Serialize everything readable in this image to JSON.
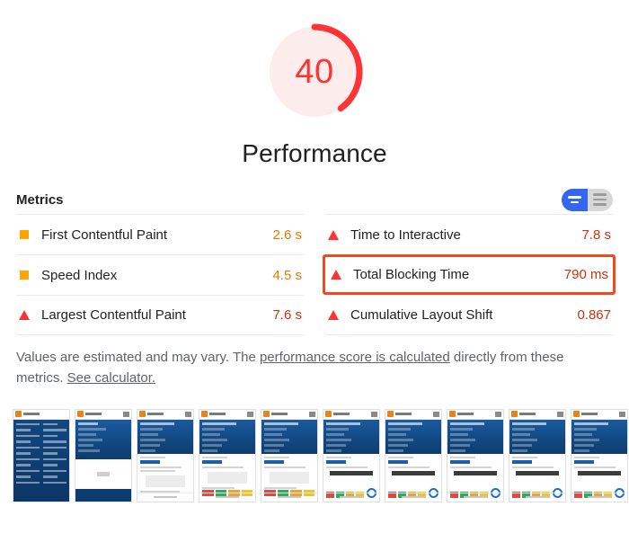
{
  "gauge": {
    "score": "40",
    "category_label": "Performance",
    "score_color": "#f33",
    "track_color": "#fdecec",
    "arc_percent": 40
  },
  "metrics_section": {
    "title": "Metrics",
    "toggle": {
      "simple_view_name": "simple-view-icon",
      "detail_view_name": "detail-view-icon",
      "active": "simple",
      "active_color": "#3367f0",
      "inactive_color": "#d8d8d8"
    },
    "left_column": [
      {
        "label": "First Contentful Paint",
        "value": "2.6 s",
        "rating": "average",
        "icon": "square-icon",
        "icon_color": "#ffa400",
        "highlighted": false
      },
      {
        "label": "Speed Index",
        "value": "4.5 s",
        "rating": "average",
        "icon": "square-icon",
        "icon_color": "#ffa400",
        "highlighted": false
      },
      {
        "label": "Largest Contentful Paint",
        "value": "7.6 s",
        "rating": "fail",
        "icon": "triangle-icon",
        "icon_color": "#f33",
        "highlighted": false
      }
    ],
    "right_column": [
      {
        "label": "Time to Interactive",
        "value": "7.8 s",
        "rating": "fail",
        "icon": "triangle-icon",
        "icon_color": "#f33",
        "highlighted": false
      },
      {
        "label": "Total Blocking Time",
        "value": "790 ms",
        "rating": "fail",
        "icon": "triangle-icon",
        "icon_color": "#f33",
        "highlighted": true,
        "highlight_color": "#f4471f"
      },
      {
        "label": "Cumulative Layout Shift",
        "value": "0.867",
        "rating": "fail",
        "icon": "triangle-icon",
        "icon_color": "#f33",
        "highlighted": false
      }
    ]
  },
  "footnote": {
    "text_before_link1": "Values are estimated and may vary. The ",
    "link1": "performance score is calculated",
    "text_between": " directly from these metrics. ",
    "link2": "See calculator.",
    "text_color": "#5f6368"
  },
  "filmstrip": {
    "frame_count": 10,
    "frames": [
      {
        "kind": "dark-text-page"
      },
      {
        "kind": "hero-blank"
      },
      {
        "kind": "hero-report-partial"
      },
      {
        "kind": "hero-report-scores"
      },
      {
        "kind": "hero-report-scores"
      },
      {
        "kind": "hero-report-gauge"
      },
      {
        "kind": "hero-report-gauge"
      },
      {
        "kind": "hero-report-gauge"
      },
      {
        "kind": "hero-report-gauge"
      },
      {
        "kind": "hero-report-gauge"
      }
    ],
    "score_bar_colors": [
      "#e8453c",
      "#2eab5b",
      "#f0a22e",
      "#f0c22e"
    ]
  }
}
